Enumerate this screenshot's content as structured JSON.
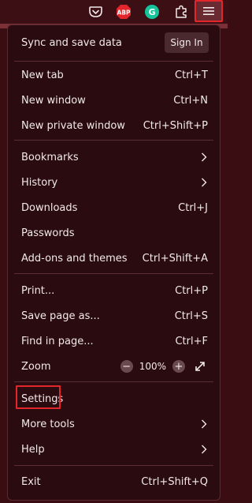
{
  "toolbar": {
    "icons": [
      "pocket-icon",
      "abp-icon",
      "grammarly-icon",
      "extensions-icon",
      "menu-icon"
    ],
    "abp_text": "ABP",
    "grammarly_text": "G"
  },
  "panel": {
    "sync": {
      "label": "Sync and save data",
      "sign_in": "Sign In"
    },
    "group1": [
      {
        "label": "New tab",
        "shortcut": "Ctrl+T"
      },
      {
        "label": "New window",
        "shortcut": "Ctrl+N"
      },
      {
        "label": "New private window",
        "shortcut": "Ctrl+Shift+P"
      }
    ],
    "group2": [
      {
        "label": "Bookmarks"
      },
      {
        "label": "History"
      },
      {
        "label": "Downloads",
        "shortcut": "Ctrl+J"
      },
      {
        "label": "Passwords"
      },
      {
        "label": "Add-ons and themes",
        "shortcut": "Ctrl+Shift+A"
      }
    ],
    "group3": [
      {
        "label": "Print...",
        "shortcut": "Ctrl+P"
      },
      {
        "label": "Save page as...",
        "shortcut": "Ctrl+S"
      },
      {
        "label": "Find in page...",
        "shortcut": "Ctrl+F"
      }
    ],
    "zoom": {
      "label": "Zoom",
      "minus": "−",
      "value": "100%",
      "plus": "+"
    },
    "group4": [
      {
        "label": "Settings"
      },
      {
        "label": "More tools"
      },
      {
        "label": "Help"
      }
    ],
    "exit": {
      "label": "Exit",
      "shortcut": "Ctrl+Shift+Q"
    }
  },
  "colors": {
    "background": "#3a0d12",
    "panel": "#2a0b0f",
    "highlight": "#e3262b"
  }
}
